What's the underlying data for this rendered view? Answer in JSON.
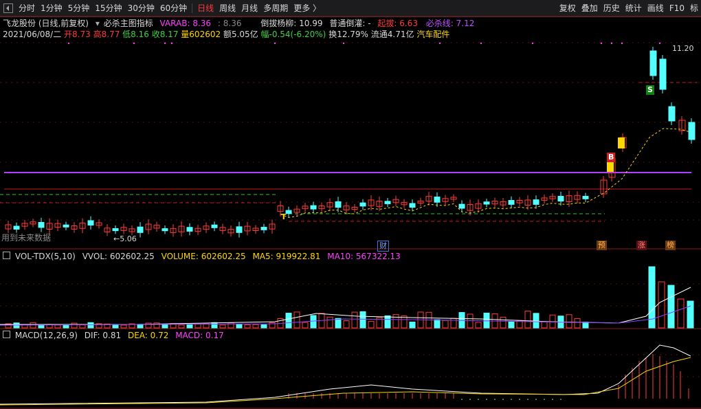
{
  "toolbar": {
    "periods": [
      "分时",
      "1分钟",
      "5分钟",
      "15分钟",
      "30分钟",
      "60分钟",
      "日线",
      "周线",
      "月线",
      "多周期",
      "更多 〉"
    ],
    "active_index": 6,
    "right_items": [
      "复权",
      "叠加",
      "历史",
      "统计",
      "画线",
      "F10",
      "标"
    ]
  },
  "info": {
    "stock_name": "飞龙股份 (日线,前复权)",
    "indicator_name": "必杀主图指标",
    "varab_label": "VARAB: 8.36",
    "varab_extra": ": 8.36",
    "daobo": "倒拔杨柳: 10.99",
    "putong": "普通倒灌: -",
    "qiba": "起拔: 6.63",
    "bisha": "必杀线: 7.12"
  },
  "quote": {
    "date": "2021/06/08/二",
    "open": "开8.73",
    "high": "高8.77",
    "low": "低8.16",
    "close": "收8.17",
    "volume": "量602602",
    "amount": "额5.05亿",
    "change": "幅-0.54(-6.20%)",
    "turnover": "换12.79%",
    "float": "流通4.71亿",
    "sector": "汽车配件"
  },
  "price_panel": {
    "high_label": "11.20",
    "low_label": "5.06",
    "watermark": "用到未来数据",
    "markers": [
      {
        "text": "财",
        "color": "#3a7bd5"
      },
      {
        "text": "预",
        "color": "#d08a30"
      },
      {
        "text": "涨",
        "color": "#d04040"
      },
      {
        "text": "榜",
        "color": "#d08a30"
      }
    ],
    "signal_b": "B",
    "signal_s": "S",
    "signal_t": "T"
  },
  "vol_panel": {
    "name": "VOL-TDX(5,10)",
    "vvol": "VVOL: 602602.25",
    "volume": "VOLUME: 602602.25",
    "ma5": "MA5: 919922.81",
    "ma10": "MA10: 567322.13"
  },
  "macd_panel": {
    "name": "MACD(12,26,9)",
    "dif": "DIF: 0.81",
    "dea": "DEA: 0.72",
    "macd": "MACD: 0.17"
  },
  "colors": {
    "up": "#ff3a3a",
    "down": "#54ffff",
    "purple": "#b040ff",
    "yellow": "#ffd700",
    "white": "#ffffff",
    "grid": "#5a1010"
  }
}
